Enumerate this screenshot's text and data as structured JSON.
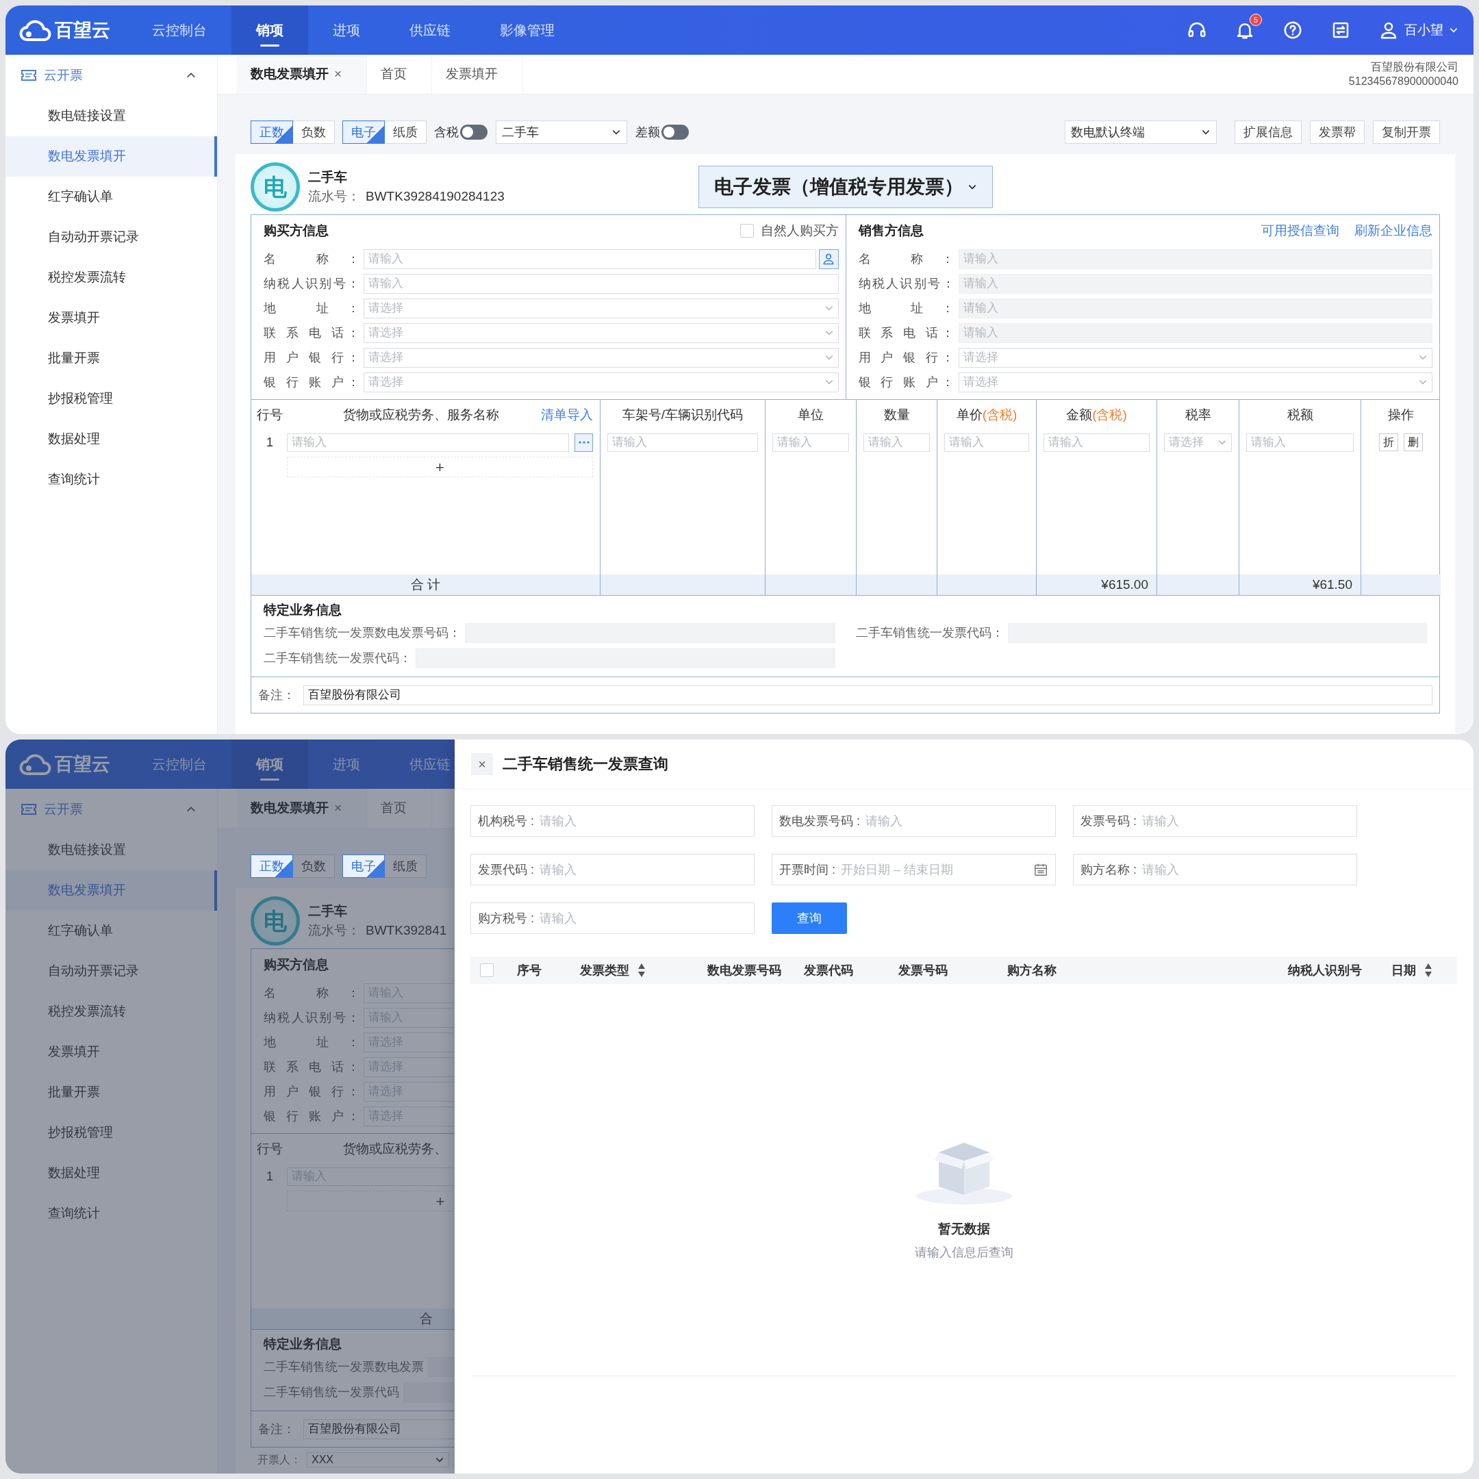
{
  "main_view": {
    "brand": "百望云",
    "nav": [
      {
        "label": "云控制台",
        "selected": false
      },
      {
        "label": "销项",
        "selected": true
      },
      {
        "label": "进项",
        "selected": false
      },
      {
        "label": "供应链",
        "selected": false
      },
      {
        "label": "影像管理",
        "selected": false
      }
    ],
    "notification_count": "5",
    "user": "百小望",
    "sidebar": {
      "group": "云开票",
      "expanded": true,
      "items": [
        {
          "label": "数电链接设置",
          "selected": false
        },
        {
          "label": "数电发票填开",
          "selected": true
        },
        {
          "label": "红字确认单",
          "selected": false
        },
        {
          "label": "自动动开票记录",
          "selected": false
        },
        {
          "label": "税控发票流转",
          "selected": false
        },
        {
          "label": "发票填开",
          "selected": false
        },
        {
          "label": "批量开票",
          "selected": false
        },
        {
          "label": "抄报税管理",
          "selected": false
        },
        {
          "label": "数据处理",
          "selected": false
        },
        {
          "label": "查询统计",
          "selected": false
        }
      ]
    },
    "page_tabs": [
      {
        "label": "数电发票填开",
        "selected": true,
        "close": "×"
      },
      {
        "label": "首页",
        "selected": false
      },
      {
        "label": "发票填开",
        "selected": false
      }
    ],
    "company": {
      "name": "百望股份有限公司",
      "tax_id": "512345678900000040"
    },
    "toolbar": {
      "sign": [
        {
          "label": "正数",
          "selected": true
        },
        {
          "label": "负数",
          "selected": false
        }
      ],
      "medium": [
        {
          "label": "电子",
          "selected": true
        },
        {
          "label": "纸质",
          "selected": false
        }
      ],
      "tax_included": {
        "label": "含税",
        "on": false
      },
      "invoice_kind": "二手车",
      "difference": {
        "label": "差额",
        "on": false
      },
      "terminal": "数电默认终端",
      "buttons": [
        "扩展信息",
        "发票帮",
        "复制开票"
      ]
    },
    "invoice": {
      "badge": "电",
      "category": "二手车",
      "serial_label": "流水号：",
      "serial": "BWTK39284190284123",
      "title": "电子发票（增值税专用发票）"
    },
    "buyer": {
      "heading": "购买方信息",
      "natural_person": {
        "label": "自然人购买方",
        "checked": false
      },
      "fields": [
        {
          "label": "名 称：",
          "placeholder": "请输入",
          "kind": "lookup",
          "disabled": false
        },
        {
          "label": "纳税人识别号：",
          "placeholder": "请输入",
          "kind": "text",
          "disabled": false
        },
        {
          "label": "地 址：",
          "placeholder": "请选择",
          "kind": "select",
          "disabled": false
        },
        {
          "label": "联 系 电 话：",
          "placeholder": "请选择",
          "kind": "select",
          "disabled": false
        },
        {
          "label": "用 户 银 行：",
          "placeholder": "请选择",
          "kind": "select",
          "disabled": false
        },
        {
          "label": "银 行 账 户：",
          "placeholder": "请选择",
          "kind": "select",
          "disabled": false
        }
      ]
    },
    "seller": {
      "heading": "销售方信息",
      "links": [
        "可用授信查询",
        "刷新企业信息"
      ],
      "fields": [
        {
          "label": "名 称：",
          "placeholder": "请输入",
          "kind": "text",
          "disabled": true
        },
        {
          "label": "纳税人识别号：",
          "placeholder": "请输入",
          "kind": "text",
          "disabled": true
        },
        {
          "label": "地 址：",
          "placeholder": "请输入",
          "kind": "text",
          "disabled": true
        },
        {
          "label": "联 系 电 话：",
          "placeholder": "请输入",
          "kind": "text",
          "disabled": true
        },
        {
          "label": "用 户 银 行：",
          "placeholder": "请选择",
          "kind": "select",
          "disabled": false
        },
        {
          "label": "银 行 账 户：",
          "placeholder": "请选择",
          "kind": "select",
          "disabled": false
        }
      ]
    },
    "goods": {
      "columns": [
        {
          "label": "行号"
        },
        {
          "label": "货物或应税劳务、服务名称",
          "link": "清单导入"
        },
        {
          "label": "车架号/车辆识别代码"
        },
        {
          "label": "单位"
        },
        {
          "label": "数量"
        },
        {
          "label": "单价",
          "note": "(含税)"
        },
        {
          "label": "金额",
          "note": "(含税)"
        },
        {
          "label": "税率"
        },
        {
          "label": "税额"
        },
        {
          "label": "操作"
        }
      ],
      "rows": [
        {
          "cells": [
            {
              "kind": "number",
              "text": "1"
            },
            {
              "kind": "picker",
              "placeholder": "请输入"
            },
            {
              "kind": "text",
              "placeholder": "请输入"
            },
            {
              "kind": "text",
              "placeholder": "请输入"
            },
            {
              "kind": "text",
              "placeholder": "请输入"
            },
            {
              "kind": "text",
              "placeholder": "请输入"
            },
            {
              "kind": "text",
              "placeholder": "请输入"
            },
            {
              "kind": "select",
              "placeholder": "请选择"
            },
            {
              "kind": "text",
              "placeholder": "请输入"
            },
            {
              "kind": "actions",
              "buttons": [
                "折",
                "删"
              ]
            }
          ]
        }
      ],
      "add_row": "+",
      "total": {
        "label": "合 计",
        "amount": "¥615.00",
        "tax": "¥61.50"
      }
    },
    "special": {
      "heading": "特定业务信息",
      "rows": [
        [
          {
            "label": "二手车销售统一发票数电发票号码："
          },
          {
            "label": "二手车销售统一发票代码："
          }
        ],
        [
          {
            "label": "二手车销售统一发票代码："
          }
        ]
      ]
    },
    "remarks": {
      "label": "备注：",
      "value": "百望股份有限公司"
    }
  },
  "backdrop": {
    "brand": "百望云",
    "nav": [
      {
        "label": "云控制台",
        "selected": false
      },
      {
        "label": "销项",
        "selected": true
      },
      {
        "label": "进项",
        "selected": false
      },
      {
        "label": "供应链",
        "selected": false
      }
    ],
    "sidebar": {
      "group": "云开票",
      "expanded": true,
      "items": [
        {
          "label": "数电链接设置",
          "selected": false
        },
        {
          "label": "数电发票填开",
          "selected": true
        },
        {
          "label": "红字确认单",
          "selected": false
        },
        {
          "label": "自动动开票记录",
          "selected": false
        },
        {
          "label": "税控发票流转",
          "selected": false
        },
        {
          "label": "发票填开",
          "selected": false
        },
        {
          "label": "批量开票",
          "selected": false
        },
        {
          "label": "抄报税管理",
          "selected": false
        },
        {
          "label": "数据处理",
          "selected": false
        },
        {
          "label": "查询统计",
          "selected": false
        }
      ]
    },
    "page_tabs": [
      {
        "label": "数电发票填开",
        "selected": true,
        "close": "×"
      },
      {
        "label": "首页",
        "selected": false
      }
    ],
    "toolbar": {
      "sign": [
        {
          "label": "正数",
          "selected": true
        },
        {
          "label": "负数",
          "selected": false
        }
      ],
      "medium": [
        {
          "label": "电子",
          "selected": true
        },
        {
          "label": "纸质",
          "selected": false
        }
      ]
    },
    "invoice": {
      "badge": "电",
      "category": "二手车",
      "serial_label": "流水号：",
      "serial": "BWTK392841"
    },
    "buyer": {
      "heading": "购买方信息",
      "fields": [
        {
          "label": "名 称：",
          "placeholder": "请输入"
        },
        {
          "label": "纳税人识别号：",
          "placeholder": "请输入"
        },
        {
          "label": "地 址：",
          "placeholder": "请选择"
        },
        {
          "label": "联 系 电 话：",
          "placeholder": "请选择"
        },
        {
          "label": "用 户 银 行：",
          "placeholder": "请选择"
        },
        {
          "label": "银 行 账 户：",
          "placeholder": "请选择"
        }
      ]
    },
    "goods": {
      "columns": [
        {
          "label": "行号"
        },
        {
          "label": "货物或应税劳务、"
        }
      ],
      "rows": [
        {
          "cells": [
            {
              "text": "1"
            },
            {
              "placeholder": "请输入"
            }
          ]
        }
      ],
      "add_row": "+",
      "total": {
        "label": "合"
      }
    },
    "special": {
      "heading": "特定业务信息",
      "rows": [
        [
          {
            "label": "二手车销售统一发票数电发票"
          }
        ],
        [
          {
            "label": "二手车销售统一发票代码"
          }
        ]
      ]
    },
    "remarks": {
      "label": "备注：",
      "value": "百望股份有限公司"
    },
    "issuer": {
      "label": "开票人：",
      "value": "XXX"
    }
  },
  "query_drawer": {
    "close": "×",
    "title": "二手车销售统一发票查询",
    "filters": [
      {
        "label": "机构税号 :",
        "placeholder": "请输入",
        "kind": "text"
      },
      {
        "label": "数电发票号码 :",
        "placeholder": "请输入",
        "kind": "text"
      },
      {
        "label": "发票号码 :",
        "placeholder": "请输入",
        "kind": "text"
      },
      {
        "label": "发票代码 :",
        "placeholder": "请输入",
        "kind": "text"
      },
      {
        "label": "开票时间 :",
        "placeholder": "开始日期 – 结束日期",
        "kind": "date"
      },
      {
        "label": "购方名称 :",
        "placeholder": "请输入",
        "kind": "text"
      },
      {
        "label": "购方税号 :",
        "placeholder": "请输入",
        "kind": "text"
      }
    ],
    "search_button": "查询",
    "select_all": {
      "checked": false
    },
    "columns": [
      {
        "label": "序号",
        "sortable": false
      },
      {
        "label": "发票类型",
        "sortable": true
      },
      {
        "label": "数电发票号码",
        "sortable": false
      },
      {
        "label": "发票代码",
        "sortable": false
      },
      {
        "label": "发票号码",
        "sortable": false
      },
      {
        "label": "购方名称",
        "sortable": false
      },
      {
        "label": "纳税人识别号",
        "sortable": false
      },
      {
        "label": "日期",
        "sortable": true
      }
    ],
    "empty": {
      "title": "暂无数据",
      "hint": "请输入信息后查询"
    }
  }
}
